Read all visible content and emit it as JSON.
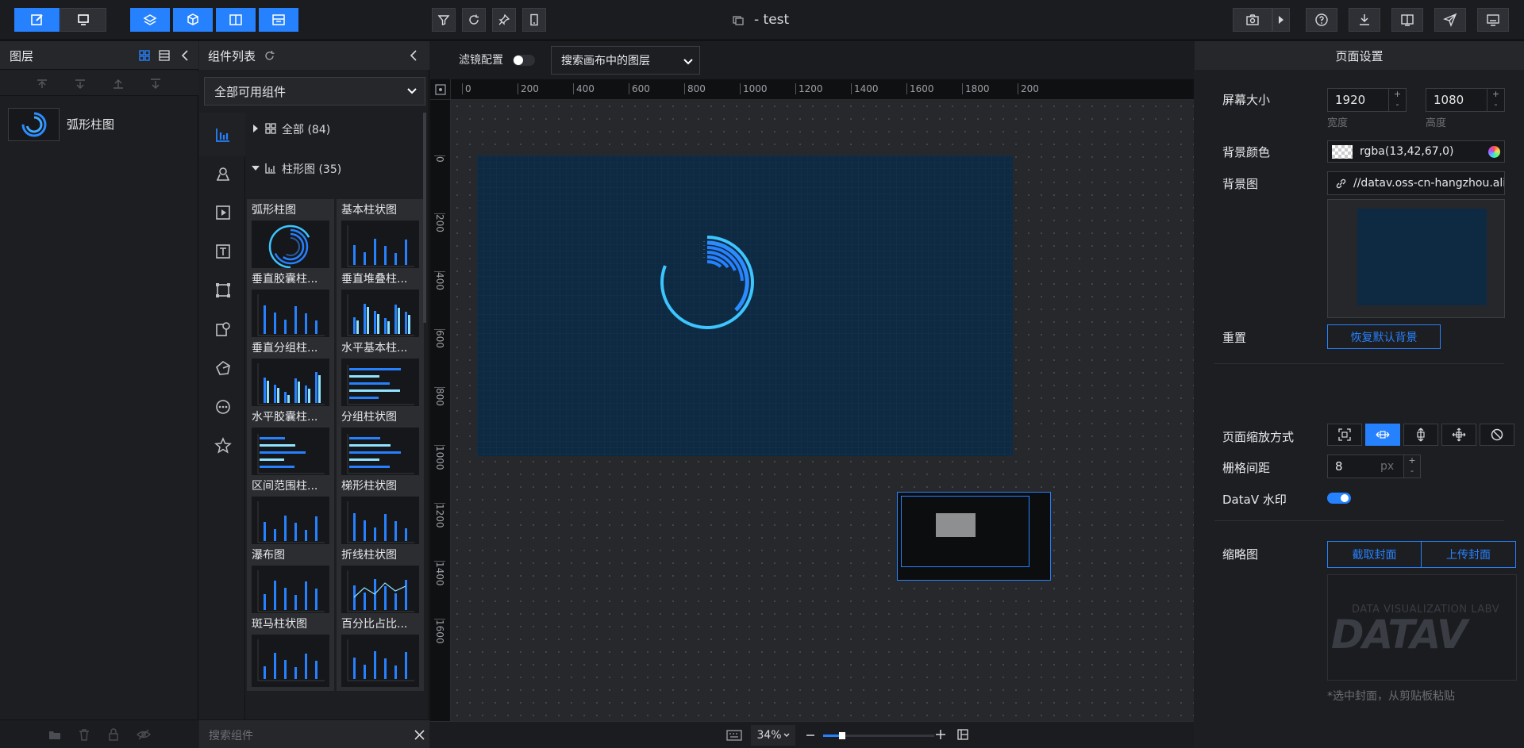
{
  "app": {
    "title": "- test"
  },
  "layers_panel": {
    "title": "图层",
    "items": [
      {
        "label": "弧形柱图"
      }
    ]
  },
  "components_panel": {
    "title": "组件列表",
    "filter_selected": "全部可用组件",
    "tree_all": "全部 (84)",
    "tree_bar": "柱形图 (35)",
    "cards": [
      {
        "label": "弧形柱图"
      },
      {
        "label": "基本柱状图"
      },
      {
        "label": "垂直胶囊柱..."
      },
      {
        "label": "垂直堆叠柱..."
      },
      {
        "label": "垂直分组柱..."
      },
      {
        "label": "水平基本柱..."
      },
      {
        "label": "水平胶囊柱..."
      },
      {
        "label": "分组柱状图"
      },
      {
        "label": "区间范围柱..."
      },
      {
        "label": "梯形柱状图"
      },
      {
        "label": "瀑布图"
      },
      {
        "label": "折线柱状图"
      },
      {
        "label": "斑马柱状图"
      },
      {
        "label": "百分比占比..."
      }
    ],
    "search_placeholder": "搜索组件"
  },
  "canvas": {
    "filter_label": "滤镜配置",
    "layer_search_placeholder": "搜索画布中的图层",
    "ruler_x": [
      "0",
      "200",
      "400",
      "600",
      "800",
      "1000",
      "1200",
      "1400",
      "1600",
      "1800",
      "200"
    ],
    "ruler_y": [
      "0",
      "200",
      "400",
      "600",
      "800",
      "1000",
      "1200",
      "1400",
      "1600"
    ],
    "zoom": "34%",
    "zoom_level": 0.34
  },
  "page_settings": {
    "title": "页面设置",
    "screen_size_label": "屏幕大小",
    "width": "1920",
    "height": "1080",
    "width_label": "宽度",
    "height_label": "高度",
    "bg_color_label": "背景颜色",
    "bg_color_value": "rgba(13,42,67,0)",
    "bg_image_label": "背景图",
    "bg_image_value": "//datav.oss-cn-hangzhou.aliyun",
    "reset_label": "重置",
    "reset_button": "恢复默认背景",
    "scale_mode_label": "页面缩放方式",
    "grid_label": "栅格间距",
    "grid_value": "8",
    "grid_unit": "px",
    "watermark_label": "DataV 水印",
    "watermark_on": true,
    "thumbnail_label": "缩略图",
    "capture_button": "截取封面",
    "upload_button": "上传封面",
    "thumb_caption": "DATA VISUALIZATION LABV",
    "thumb_logo": "DATAV",
    "thumb_hint": "*选中封面，从剪贴板粘贴"
  },
  "colors": {
    "accent": "#2681ff",
    "canvas_bg": "#0e2a43",
    "panel": "#1d1e21"
  }
}
